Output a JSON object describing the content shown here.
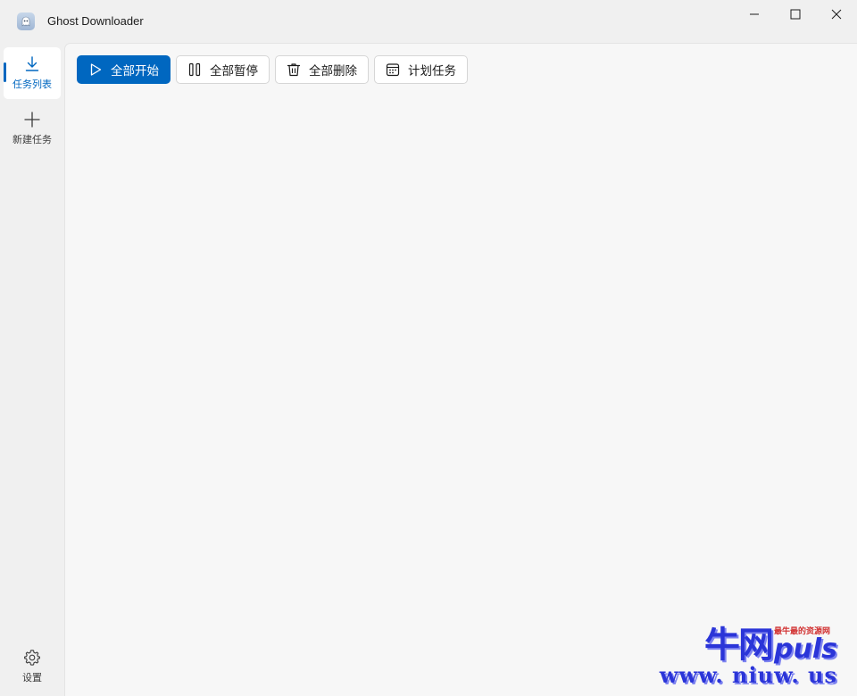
{
  "window": {
    "title": "Ghost Downloader",
    "app_icon": "ghost-icon"
  },
  "window_controls": {
    "minimize_icon": "minimize-icon",
    "maximize_icon": "maximize-icon",
    "close_icon": "close-icon"
  },
  "sidebar": {
    "items": [
      {
        "label": "任务列表",
        "icon": "download-icon",
        "active": true
      },
      {
        "label": "新建任务",
        "icon": "plus-icon",
        "active": false
      }
    ],
    "settings": {
      "label": "设置",
      "icon": "gear-icon"
    }
  },
  "toolbar": {
    "start_all": {
      "label": "全部开始",
      "icon": "play-icon"
    },
    "pause_all": {
      "label": "全部暂停",
      "icon": "pause-icon"
    },
    "delete_all": {
      "label": "全部删除",
      "icon": "trash-icon"
    },
    "schedule": {
      "label": "计划任务",
      "icon": "calendar-icon"
    }
  },
  "watermark": {
    "brand_cn": "牛网",
    "brand_en": "puls",
    "slogan": "最牛最的资源网",
    "url": "www. niuw. us"
  },
  "colors": {
    "accent": "#0067c0",
    "watermark_blue": "#2b35d8",
    "watermark_red": "#d12f2f"
  }
}
